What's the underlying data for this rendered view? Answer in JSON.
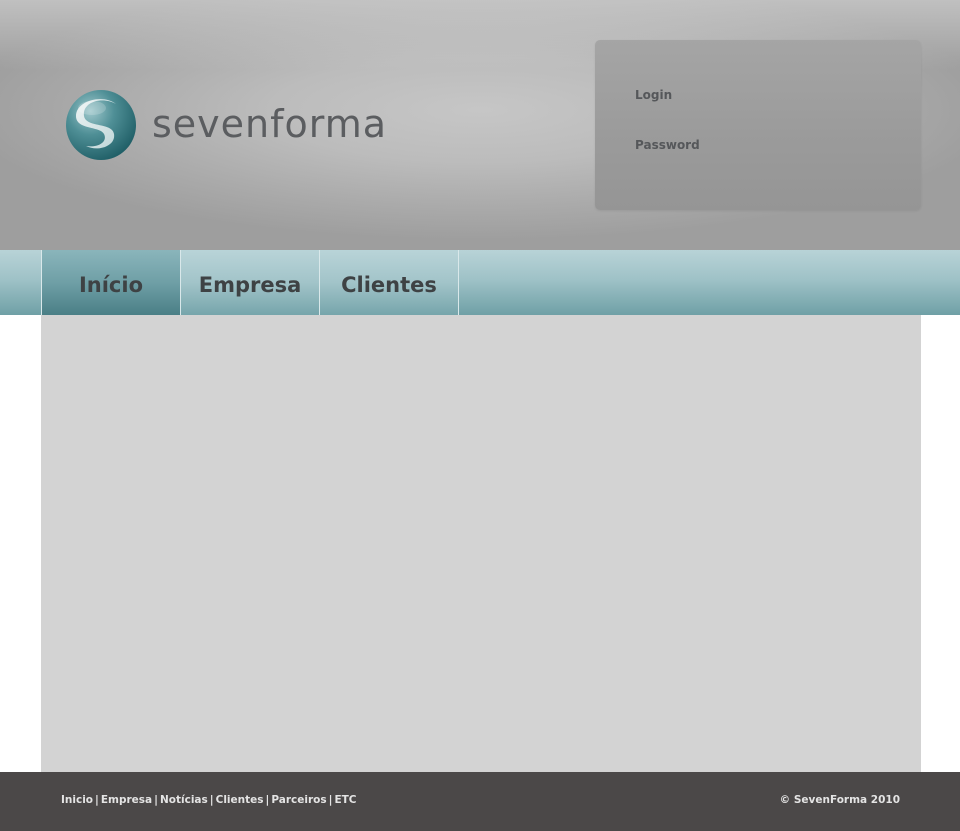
{
  "brand": {
    "name": "sevenforma",
    "colors": {
      "mark_dark": "#2f6f76",
      "mark_light": "#7fb3b8",
      "text": "#5b5d60"
    }
  },
  "login": {
    "login_label": "Login",
    "password_label": "Password"
  },
  "nav": {
    "items": [
      {
        "label": "Início",
        "active": true
      },
      {
        "label": "Empresa",
        "active": false
      },
      {
        "label": "Clientes",
        "active": false
      }
    ]
  },
  "footer": {
    "links": [
      "Inicio",
      "Empresa",
      "Notícias",
      "Clientes",
      "Parceiros",
      "ETC"
    ],
    "separator": "|",
    "copyright": "© SevenForma 2010"
  }
}
